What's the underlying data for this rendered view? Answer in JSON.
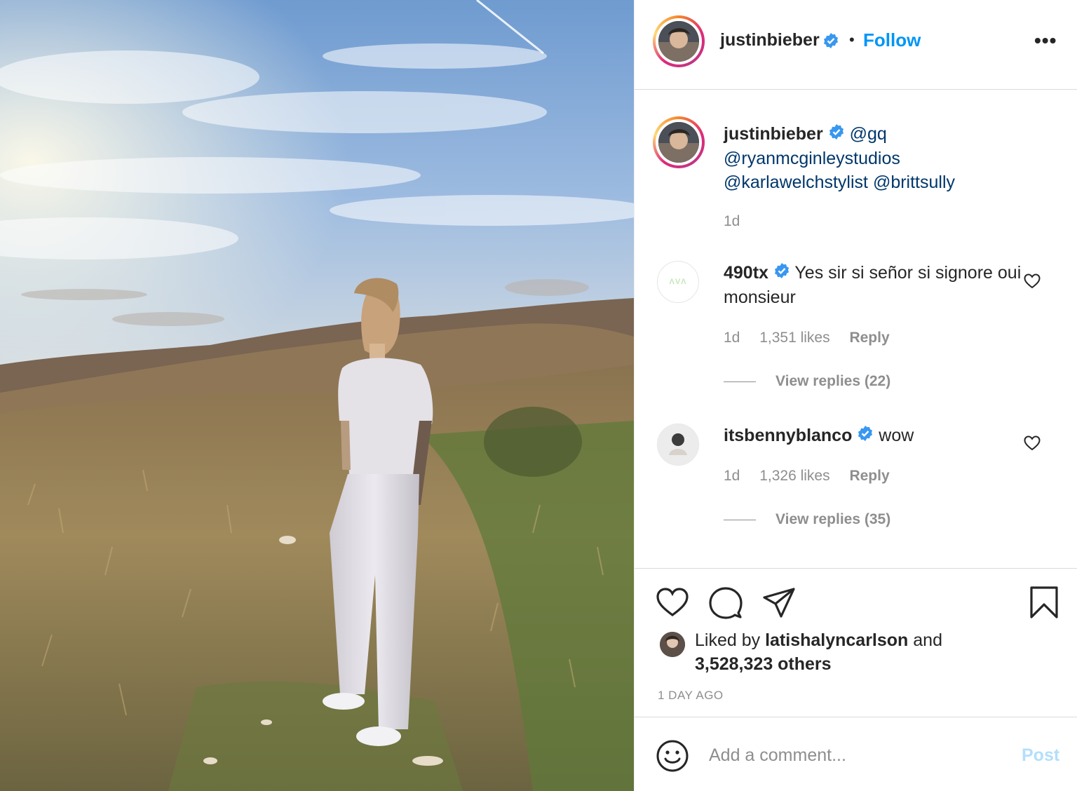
{
  "post": {
    "username": "justinbieber",
    "dot": "•",
    "follow_label": "Follow",
    "more_label": "•••"
  },
  "caption": {
    "username": "justinbieber",
    "mentions": [
      "@gq",
      "@ryanmcginleystudios",
      "@karlawelchstylist",
      "@brittsully"
    ],
    "time": "1d"
  },
  "comments": [
    {
      "username": "490tx",
      "text": "Yes sir si señor si signore oui monsieur",
      "time": "1d",
      "likes": "1,351 likes",
      "reply_label": "Reply",
      "view_replies": "View replies (22)",
      "avatar_text": "ΛVΛ"
    },
    {
      "username": "itsbennyblanco",
      "text": "wow",
      "time": "1d",
      "likes": "1,326 likes",
      "reply_label": "Reply",
      "view_replies": "View replies (35)"
    }
  ],
  "likes": {
    "prefix": "Liked by",
    "user": "latishalyncarlson",
    "and": "and",
    "others": "3,528,323 others"
  },
  "timestamp": "1 DAY AGO",
  "comment_box": {
    "placeholder": "Add a comment...",
    "post_label": "Post"
  },
  "colors": {
    "accent": "#0095f6",
    "verified": "#3897f0",
    "muted": "#8e8e8e",
    "post_disabled": "#b2dffc"
  },
  "icons": {
    "verified": "verified-badge-icon",
    "like": "heart-icon",
    "comment": "comment-bubble-icon",
    "share": "paper-plane-icon",
    "save": "bookmark-icon",
    "emoji": "smiley-icon",
    "more": "more-options-icon"
  }
}
